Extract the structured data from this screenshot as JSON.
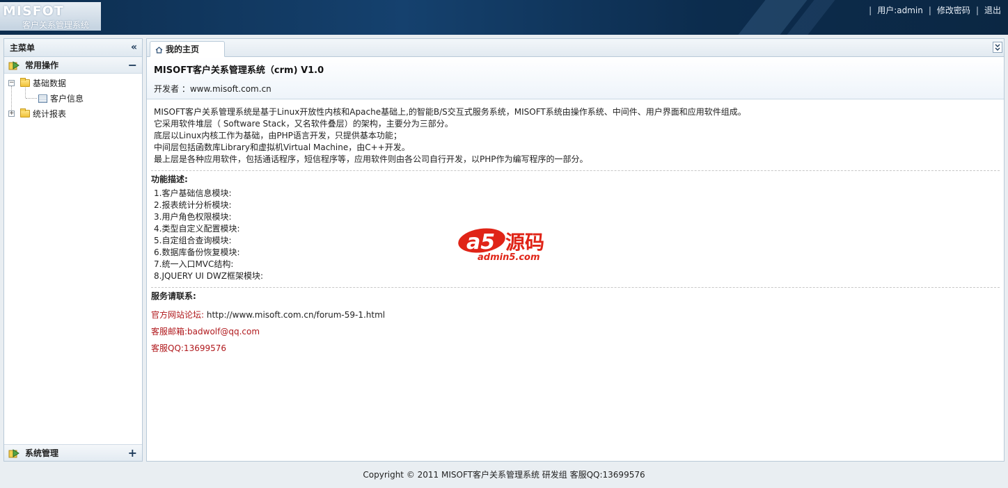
{
  "header": {
    "logo_title": "MISFOT",
    "logo_subtitle": "客户关系管理系统",
    "user_label": "用户:admin",
    "change_password": "修改密码",
    "logout": "退出"
  },
  "sidebar": {
    "title": "主菜单",
    "collapse_icon": "«",
    "group_common": "常用操作",
    "group_common_toggle": "−",
    "tree": {
      "basic_data": "基础数据",
      "basic_data_toggle": "−",
      "customer_info": "客户信息",
      "stats_report": "统计报表",
      "stats_report_toggle": "+"
    },
    "group_system": "系统管理",
    "group_system_toggle": "+"
  },
  "tabs": {
    "home": "我的主页",
    "more_icon": "»"
  },
  "info": {
    "title": "MISOFT客户关系管理系统（crm) V1.0",
    "developer": "开发者 ：www.misoft.com.cn"
  },
  "intro": [
    "MISOFT客户关系管理系统是基于Linux开放性内核和Apache基础上,的智能B/S交互式服务系统，MISOFT系统由操作系统、中间件、用户界面和应用软件组成。",
    "它采用软件堆层（ Software Stack，又名软件叠层）的架构，主要分为三部分。",
    "底层以Linux内核工作为基础，由PHP语言开发，只提供基本功能；",
    "中间层包括函数库Library和虚拟机Virtual Machine，由C++开发。",
    "最上层是各种应用软件，包括通话程序，短信程序等，应用软件则由各公司自行开发，以PHP作为编写程序的一部分。"
  ],
  "features_title": "功能描述:",
  "features": [
    "1.客户基础信息模块:",
    "2.报表统计分析模块:",
    "3.用户角色权限模块:",
    "4.类型自定义配置模块:",
    "5.自定组合查询模块:",
    "6.数据库备份恢复模块:",
    "7.统一入口MVC结构:",
    "8.JQUERY UI DWZ框架模块:"
  ],
  "service_title": "服务请联系:",
  "contact": {
    "forum_label": "官方网站论坛:",
    "forum_url": " http://www.misoft.com.cn/forum-59-1.html",
    "email": "客服邮箱:badwolf@qq.com",
    "qq": "客服QQ:13699576"
  },
  "watermark": {
    "logo": "a5",
    "cn": "源码",
    "domain": "admin5.com"
  },
  "footer": "Copyright © 2011 MISOFT客户关系管理系统  研发组  客服QQ:13699576"
}
